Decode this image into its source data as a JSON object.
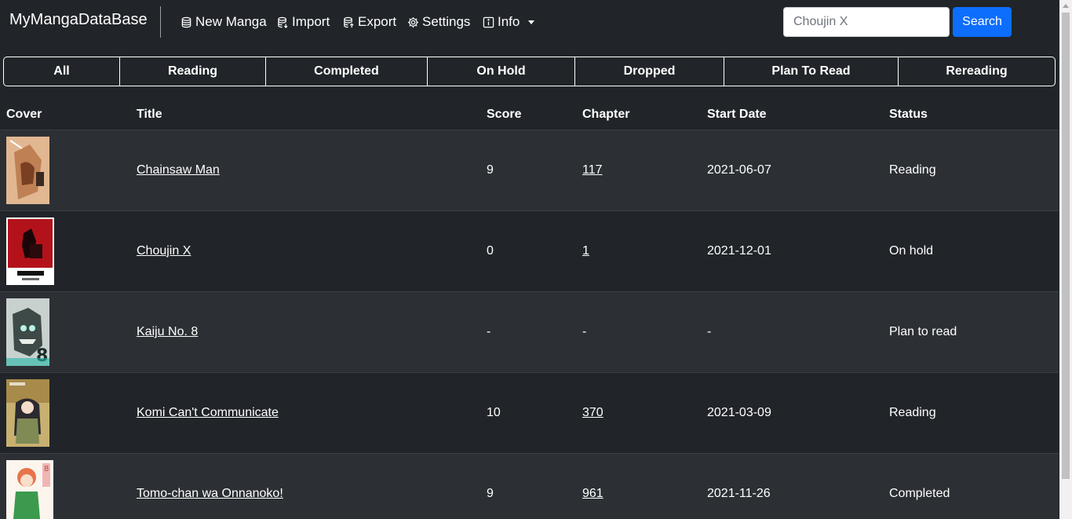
{
  "nav": {
    "brand": "MyMangaDataBase",
    "items": [
      {
        "label": "New Manga",
        "icon": "database-icon"
      },
      {
        "label": "Import",
        "icon": "database-import-icon"
      },
      {
        "label": "Export",
        "icon": "database-export-icon"
      },
      {
        "label": "Settings",
        "icon": "gear-icon"
      },
      {
        "label": "Info",
        "icon": "info-square-icon"
      }
    ],
    "search": {
      "placeholder": "Choujin X",
      "button": "Search"
    }
  },
  "tabs": [
    "All",
    "Reading",
    "Completed",
    "On Hold",
    "Dropped",
    "Plan To Read",
    "Rereading"
  ],
  "table": {
    "headers": [
      "Cover",
      "Title",
      "Score",
      "Chapter",
      "Start Date",
      "Status"
    ],
    "rows": [
      {
        "title": "Chainsaw Man",
        "score": "9",
        "chapter": "117",
        "start_date": "2021-06-07",
        "status": "Reading"
      },
      {
        "title": "Choujin X",
        "score": "0",
        "chapter": "1",
        "start_date": "2021-12-01",
        "status": "On hold"
      },
      {
        "title": "Kaiju No. 8",
        "score": "-",
        "chapter": "-",
        "start_date": "-",
        "status": "Plan to read"
      },
      {
        "title": "Komi Can't Communicate",
        "score": "10",
        "chapter": "370",
        "start_date": "2021-03-09",
        "status": "Reading"
      },
      {
        "title": "Tomo-chan wa Onnanoko!",
        "score": "9",
        "chapter": "961",
        "start_date": "2021-11-26",
        "status": "Completed"
      }
    ]
  },
  "colors": {
    "background": "#212529",
    "stripe": "#2c3034",
    "primary": "#0d6efd"
  }
}
